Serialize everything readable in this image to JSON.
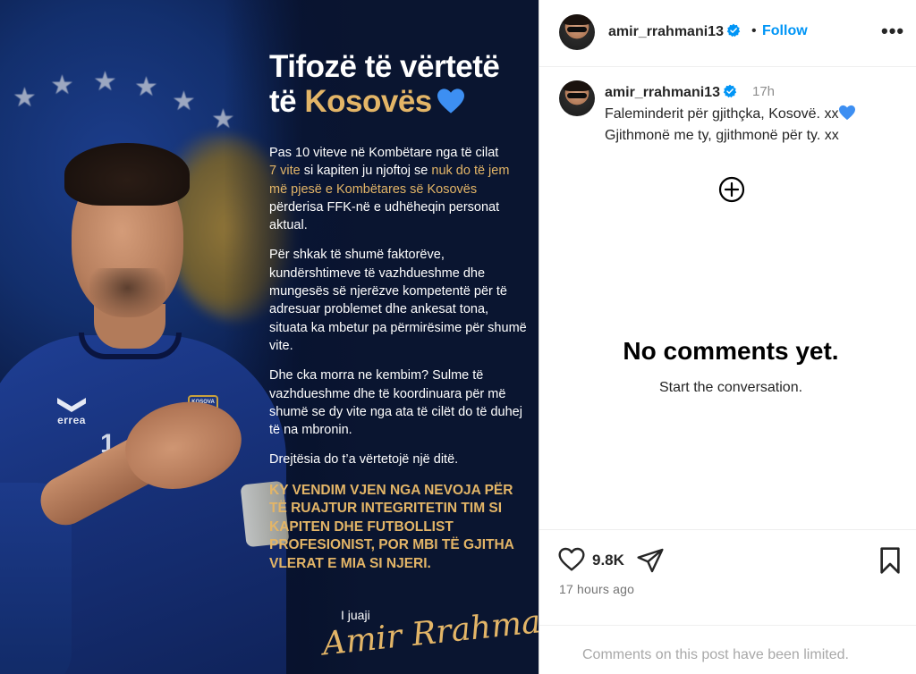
{
  "post_image": {
    "title_line1": "Tifozë të vërtetë",
    "title_line2_prefix": "të ",
    "title_line2_highlight": "Kosovës",
    "para1": {
      "t1": "Pas 10 viteve në Kombëtare nga të cilat",
      "t2_highlight": "7 vite",
      "t3": " si kapiten ju njoftoj se ",
      "t4_highlight": "nuk do të jem më pjesë e Kombëtares së Kosovës",
      "t5": " përderisa FFK-në e udhëheqin personat aktual."
    },
    "para2": "Për shkak të shumë faktorëve, kundërshtimeve të vazhdueshme dhe mungesës së njerëzve kompetentë për të adresuar problemet dhe ankesat tona, situata ka mbetur pa përmirësime për shumë vite.",
    "para3": "Dhe cka morra ne kembim? Sulme të vazhdueshme dhe të koordinuara për më shumë se dy vite nga ata të cilët do të duhej të na mbronin.",
    "para4": "Drejtësia do t’a vërtetojë një ditë.",
    "caps_statement": "KY VENDIM VJEN NGA NEVOJA PËR TË RUAJTUR INTEGRITETIN TIM SI KAPITEN DHE FUTBOLLIST PROFESIONIST, POR MBI TË GJITHA VLERAT E MIA SI NJERI.",
    "signoff": "I juaji",
    "signature": "Amir Rrahmani",
    "shirt_brand": "errea",
    "crest_label": "KOSOVA",
    "shirt_number": "1"
  },
  "header": {
    "username": "amir_rrahmani13",
    "separator": "•",
    "follow_label": "Follow",
    "more_label": "•••"
  },
  "caption": {
    "username": "amir_rrahmani13",
    "time": "17h",
    "line1": "Faleminderit për gjithçka, Kosovë. xx",
    "line2": "Gjithmonë me ty, gjithmonë për ty. xx"
  },
  "comments": {
    "empty_title": "No comments yet.",
    "empty_subtitle": "Start the conversation."
  },
  "actions": {
    "like_count": "9.8K",
    "post_age": "17 hours ago"
  },
  "footer": {
    "limited_text": "Comments on this post have been limited."
  },
  "icons": {
    "verified": "verified-badge-icon",
    "like": "heart-outline-icon",
    "share": "send-icon",
    "save": "bookmark-icon",
    "load_more": "plus-circle-icon",
    "heart_emoji": "blue-heart-icon"
  },
  "colors": {
    "accent_gold": "#e3b567",
    "follow_blue": "#0095f6",
    "verified_blue": "#0095f6",
    "heart_blue": "#3d8ff2",
    "muted_gray": "#8e8e8e"
  }
}
